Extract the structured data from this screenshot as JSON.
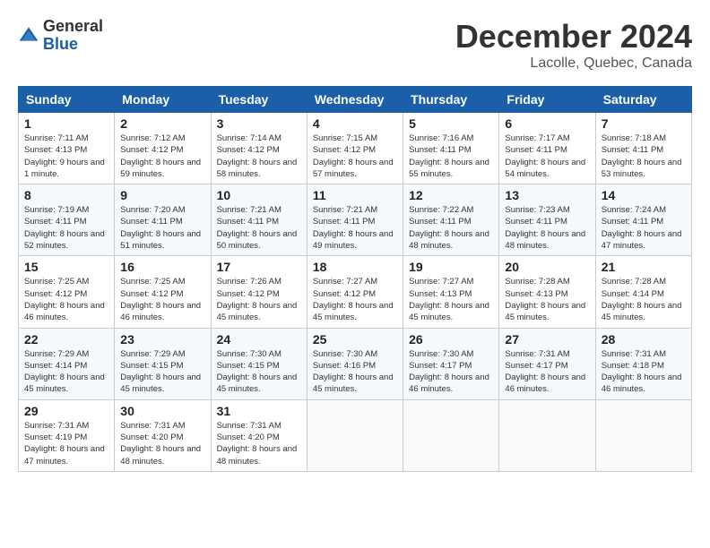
{
  "header": {
    "logo_general": "General",
    "logo_blue": "Blue",
    "month_title": "December 2024",
    "location": "Lacolle, Quebec, Canada"
  },
  "weekdays": [
    "Sunday",
    "Monday",
    "Tuesday",
    "Wednesday",
    "Thursday",
    "Friday",
    "Saturday"
  ],
  "weeks": [
    [
      {
        "day": "1",
        "sunrise": "7:11 AM",
        "sunset": "4:13 PM",
        "daylight": "9 hours and 1 minute."
      },
      {
        "day": "2",
        "sunrise": "7:12 AM",
        "sunset": "4:12 PM",
        "daylight": "8 hours and 59 minutes."
      },
      {
        "day": "3",
        "sunrise": "7:14 AM",
        "sunset": "4:12 PM",
        "daylight": "8 hours and 58 minutes."
      },
      {
        "day": "4",
        "sunrise": "7:15 AM",
        "sunset": "4:12 PM",
        "daylight": "8 hours and 57 minutes."
      },
      {
        "day": "5",
        "sunrise": "7:16 AM",
        "sunset": "4:11 PM",
        "daylight": "8 hours and 55 minutes."
      },
      {
        "day": "6",
        "sunrise": "7:17 AM",
        "sunset": "4:11 PM",
        "daylight": "8 hours and 54 minutes."
      },
      {
        "day": "7",
        "sunrise": "7:18 AM",
        "sunset": "4:11 PM",
        "daylight": "8 hours and 53 minutes."
      }
    ],
    [
      {
        "day": "8",
        "sunrise": "7:19 AM",
        "sunset": "4:11 PM",
        "daylight": "8 hours and 52 minutes."
      },
      {
        "day": "9",
        "sunrise": "7:20 AM",
        "sunset": "4:11 PM",
        "daylight": "8 hours and 51 minutes."
      },
      {
        "day": "10",
        "sunrise": "7:21 AM",
        "sunset": "4:11 PM",
        "daylight": "8 hours and 50 minutes."
      },
      {
        "day": "11",
        "sunrise": "7:21 AM",
        "sunset": "4:11 PM",
        "daylight": "8 hours and 49 minutes."
      },
      {
        "day": "12",
        "sunrise": "7:22 AM",
        "sunset": "4:11 PM",
        "daylight": "8 hours and 48 minutes."
      },
      {
        "day": "13",
        "sunrise": "7:23 AM",
        "sunset": "4:11 PM",
        "daylight": "8 hours and 48 minutes."
      },
      {
        "day": "14",
        "sunrise": "7:24 AM",
        "sunset": "4:11 PM",
        "daylight": "8 hours and 47 minutes."
      }
    ],
    [
      {
        "day": "15",
        "sunrise": "7:25 AM",
        "sunset": "4:12 PM",
        "daylight": "8 hours and 46 minutes."
      },
      {
        "day": "16",
        "sunrise": "7:25 AM",
        "sunset": "4:12 PM",
        "daylight": "8 hours and 46 minutes."
      },
      {
        "day": "17",
        "sunrise": "7:26 AM",
        "sunset": "4:12 PM",
        "daylight": "8 hours and 45 minutes."
      },
      {
        "day": "18",
        "sunrise": "7:27 AM",
        "sunset": "4:12 PM",
        "daylight": "8 hours and 45 minutes."
      },
      {
        "day": "19",
        "sunrise": "7:27 AM",
        "sunset": "4:13 PM",
        "daylight": "8 hours and 45 minutes."
      },
      {
        "day": "20",
        "sunrise": "7:28 AM",
        "sunset": "4:13 PM",
        "daylight": "8 hours and 45 minutes."
      },
      {
        "day": "21",
        "sunrise": "7:28 AM",
        "sunset": "4:14 PM",
        "daylight": "8 hours and 45 minutes."
      }
    ],
    [
      {
        "day": "22",
        "sunrise": "7:29 AM",
        "sunset": "4:14 PM",
        "daylight": "8 hours and 45 minutes."
      },
      {
        "day": "23",
        "sunrise": "7:29 AM",
        "sunset": "4:15 PM",
        "daylight": "8 hours and 45 minutes."
      },
      {
        "day": "24",
        "sunrise": "7:30 AM",
        "sunset": "4:15 PM",
        "daylight": "8 hours and 45 minutes."
      },
      {
        "day": "25",
        "sunrise": "7:30 AM",
        "sunset": "4:16 PM",
        "daylight": "8 hours and 45 minutes."
      },
      {
        "day": "26",
        "sunrise": "7:30 AM",
        "sunset": "4:17 PM",
        "daylight": "8 hours and 46 minutes."
      },
      {
        "day": "27",
        "sunrise": "7:31 AM",
        "sunset": "4:17 PM",
        "daylight": "8 hours and 46 minutes."
      },
      {
        "day": "28",
        "sunrise": "7:31 AM",
        "sunset": "4:18 PM",
        "daylight": "8 hours and 46 minutes."
      }
    ],
    [
      {
        "day": "29",
        "sunrise": "7:31 AM",
        "sunset": "4:19 PM",
        "daylight": "8 hours and 47 minutes."
      },
      {
        "day": "30",
        "sunrise": "7:31 AM",
        "sunset": "4:20 PM",
        "daylight": "8 hours and 48 minutes."
      },
      {
        "day": "31",
        "sunrise": "7:31 AM",
        "sunset": "4:20 PM",
        "daylight": "8 hours and 48 minutes."
      },
      null,
      null,
      null,
      null
    ]
  ],
  "labels": {
    "sunrise": "Sunrise: ",
    "sunset": "Sunset: ",
    "daylight": "Daylight: "
  }
}
